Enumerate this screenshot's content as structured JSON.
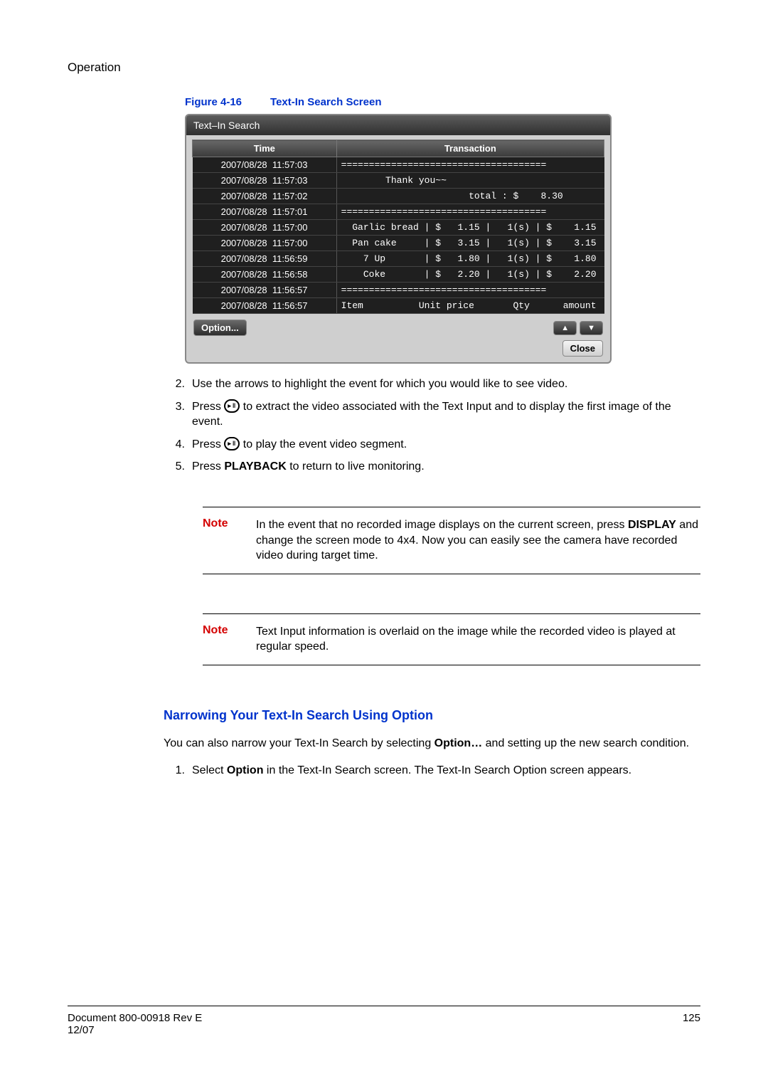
{
  "header": {
    "section": "Operation"
  },
  "figure": {
    "label": "Figure 4-16",
    "title": "Text-In Search Screen"
  },
  "shot": {
    "title": "Text–In Search",
    "col_time": "Time",
    "col_trans": "Transaction",
    "rows": [
      {
        "time": "2007/08/28  11:57:03",
        "text": "====================================="
      },
      {
        "time": "2007/08/28  11:57:03",
        "text": "        Thank you~~"
      },
      {
        "time": "2007/08/28  11:57:02",
        "text": "                       total : $    8.30"
      },
      {
        "time": "2007/08/28  11:57:01",
        "text": "====================================="
      },
      {
        "time": "2007/08/28  11:57:00",
        "text": "  Garlic bread | $   1.15 |   1(s) | $    1.15"
      },
      {
        "time": "2007/08/28  11:57:00",
        "text": "  Pan cake     | $   3.15 |   1(s) | $    3.15"
      },
      {
        "time": "2007/08/28  11:56:59",
        "text": "    7 Up       | $   1.80 |   1(s) | $    1.80"
      },
      {
        "time": "2007/08/28  11:56:58",
        "text": "    Coke       | $   2.20 |   1(s) | $    2.20"
      },
      {
        "time": "2007/08/28  11:56:57",
        "text": "====================================="
      },
      {
        "time": "2007/08/28  11:56:57",
        "text": "Item          Unit price       Qty      amount"
      }
    ],
    "option_btn": "Option...",
    "close_btn": "Close"
  },
  "steps": {
    "s2": "Use the arrows to highlight the event for which you would like to see video.",
    "s3a": "Press ",
    "s3b": " to extract the video associated with the Text Input and to display the first image of the event.",
    "s4a": "Press ",
    "s4b": " to play the event video segment.",
    "s5a": "Press ",
    "s5b": "PLAYBACK",
    "s5c": " to return to live monitoring."
  },
  "note1": {
    "label": "Note",
    "t1": "In the event that no recorded image displays on the current screen, press ",
    "bold": "DISPLAY",
    "t2": " and change the screen mode to 4x4. Now you can easily see the camera have recorded video during target time."
  },
  "note2": {
    "label": "Note",
    "text": "Text Input information is overlaid on the image while the recorded video is played at regular speed."
  },
  "subheading": "Narrowing Your Text-In Search Using Option",
  "para1a": "You can also narrow your Text-In Search by selecting ",
  "para1bold": "Option…",
  "para1b": " and setting up the new search condition.",
  "step1a": "Select ",
  "step1bold": "Option",
  "step1b": " in the Text-In Search screen. The Text-In Search Option screen appears.",
  "footer": {
    "doc": "Document 800-00918 Rev E",
    "date": "12/07",
    "page": "125"
  }
}
